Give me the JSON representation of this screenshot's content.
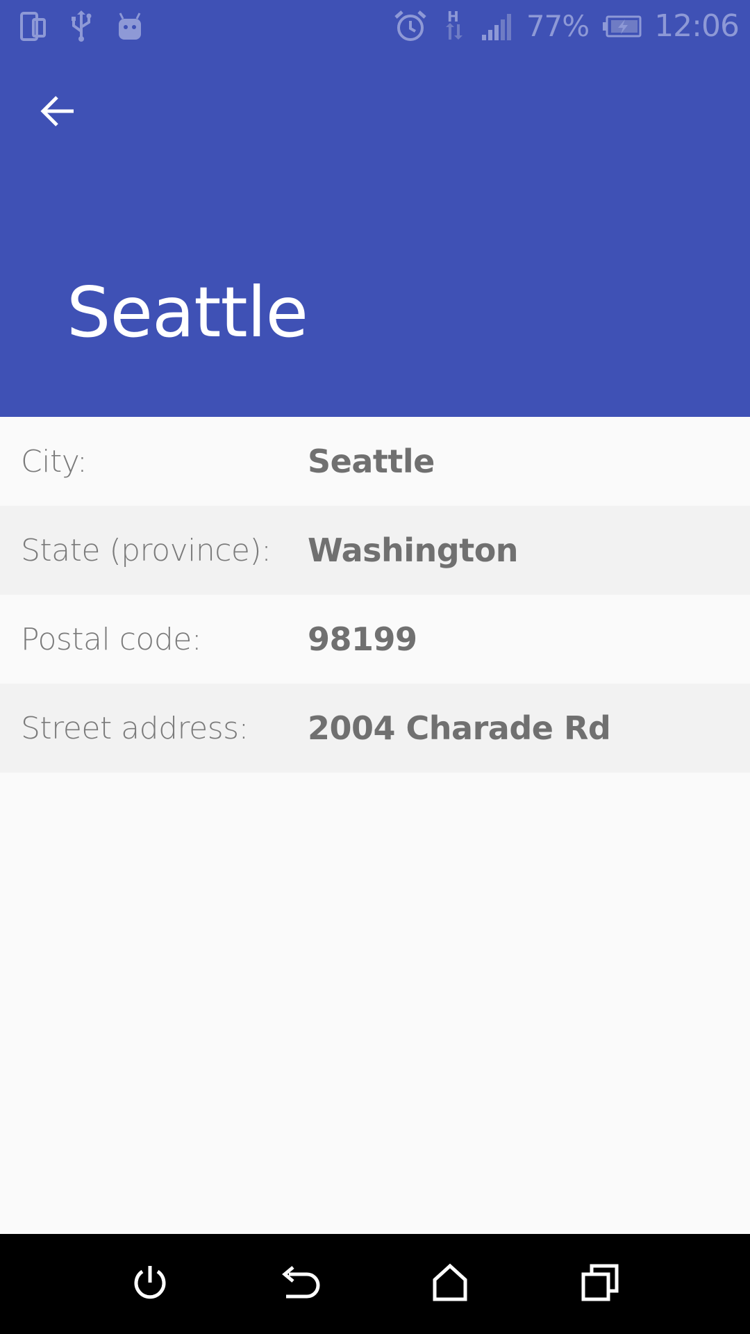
{
  "status_bar": {
    "battery_percent": "77%",
    "time": "12:06",
    "network_type": "H",
    "icons": [
      "screen-rotate-icon",
      "usb-icon",
      "android-debug-icon",
      "alarm-icon",
      "network-data-icon",
      "signal-icon",
      "battery-charging-icon"
    ]
  },
  "app_bar": {
    "title": "Seattle",
    "back_icon": "arrow-back-icon",
    "background_color": "#3f51b5"
  },
  "details": [
    {
      "label": "City:",
      "value": "Seattle"
    },
    {
      "label": "State (province):",
      "value": "Washington"
    },
    {
      "label": "Postal code:",
      "value": "98199"
    },
    {
      "label": "Street address:",
      "value": "2004 Charade Rd"
    }
  ],
  "nav_bar": {
    "buttons": [
      "power-icon",
      "back-icon",
      "home-icon",
      "recents-icon"
    ]
  }
}
